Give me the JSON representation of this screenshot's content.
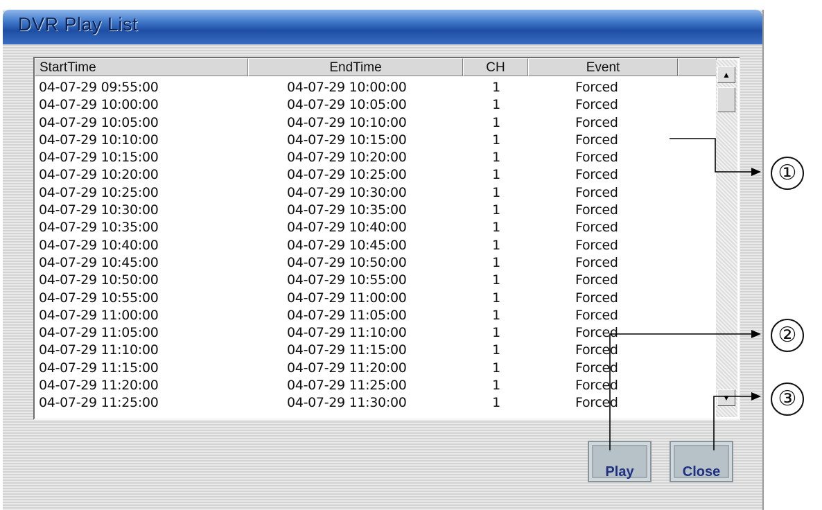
{
  "window": {
    "title": "DVR Play List"
  },
  "columns": [
    {
      "label": "StartTime"
    },
    {
      "label": "EndTime"
    },
    {
      "label": "CH"
    },
    {
      "label": "Event"
    }
  ],
  "rows": [
    {
      "start": "04-07-29 09:55:00",
      "end": "04-07-29 10:00:00",
      "ch": "1",
      "event": "Forced"
    },
    {
      "start": "04-07-29 10:00:00",
      "end": "04-07-29 10:05:00",
      "ch": "1",
      "event": "Forced"
    },
    {
      "start": "04-07-29 10:05:00",
      "end": "04-07-29 10:10:00",
      "ch": "1",
      "event": "Forced"
    },
    {
      "start": "04-07-29 10:10:00",
      "end": "04-07-29 10:15:00",
      "ch": "1",
      "event": "Forced"
    },
    {
      "start": "04-07-29 10:15:00",
      "end": "04-07-29 10:20:00",
      "ch": "1",
      "event": "Forced"
    },
    {
      "start": "04-07-29 10:20:00",
      "end": "04-07-29 10:25:00",
      "ch": "1",
      "event": "Forced"
    },
    {
      "start": "04-07-29 10:25:00",
      "end": "04-07-29 10:30:00",
      "ch": "1",
      "event": "Forced"
    },
    {
      "start": "04-07-29 10:30:00",
      "end": "04-07-29 10:35:00",
      "ch": "1",
      "event": "Forced"
    },
    {
      "start": "04-07-29 10:35:00",
      "end": "04-07-29 10:40:00",
      "ch": "1",
      "event": "Forced"
    },
    {
      "start": "04-07-29 10:40:00",
      "end": "04-07-29 10:45:00",
      "ch": "1",
      "event": "Forced"
    },
    {
      "start": "04-07-29 10:45:00",
      "end": "04-07-29 10:50:00",
      "ch": "1",
      "event": "Forced"
    },
    {
      "start": "04-07-29 10:50:00",
      "end": "04-07-29 10:55:00",
      "ch": "1",
      "event": "Forced"
    },
    {
      "start": "04-07-29 10:55:00",
      "end": "04-07-29 11:00:00",
      "ch": "1",
      "event": "Forced"
    },
    {
      "start": "04-07-29 11:00:00",
      "end": "04-07-29 11:05:00",
      "ch": "1",
      "event": "Forced"
    },
    {
      "start": "04-07-29 11:05:00",
      "end": "04-07-29 11:10:00",
      "ch": "1",
      "event": "Forced"
    },
    {
      "start": "04-07-29 11:10:00",
      "end": "04-07-29 11:15:00",
      "ch": "1",
      "event": "Forced"
    },
    {
      "start": "04-07-29 11:15:00",
      "end": "04-07-29 11:20:00",
      "ch": "1",
      "event": "Forced"
    },
    {
      "start": "04-07-29 11:20:00",
      "end": "04-07-29 11:25:00",
      "ch": "1",
      "event": "Forced"
    },
    {
      "start": "04-07-29 11:25:00",
      "end": "04-07-29 11:30:00",
      "ch": "1",
      "event": "Forced"
    }
  ],
  "buttons": {
    "play": "Play",
    "close": "Close"
  },
  "callouts": {
    "one": "①",
    "two": "②",
    "three": "③"
  },
  "icons": {
    "scroll_up": "arrow-up-icon",
    "scroll_down": "arrow-down-icon"
  },
  "colors": {
    "title_bar": "#1d4ea4",
    "button_text": "#1d2f80"
  }
}
